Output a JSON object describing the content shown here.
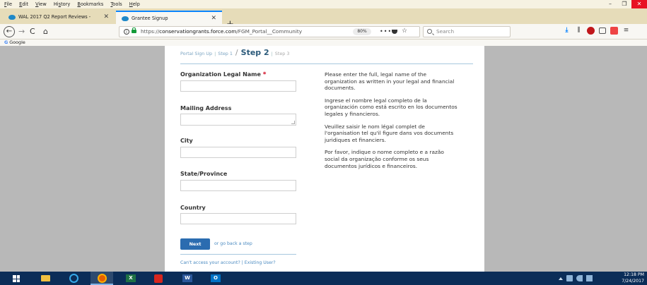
{
  "menubar": {
    "items": [
      {
        "key": "F",
        "rest": "ile"
      },
      {
        "key": "E",
        "rest": "dit"
      },
      {
        "key": "V",
        "rest": "iew"
      },
      {
        "key": "",
        "rest": "Hi",
        "key2": "s",
        "rest2": "tory"
      },
      {
        "key": "B",
        "rest": "ookmarks"
      },
      {
        "key": "T",
        "rest": "ools"
      },
      {
        "key": "H",
        "rest": "elp"
      }
    ],
    "window_controls": {
      "minimize": "–",
      "maximize": "❐",
      "close": "✕"
    }
  },
  "tabs": [
    {
      "title": "WAL 2017 Q2 Report Reviews -",
      "close": "✕",
      "active": false
    },
    {
      "title": "Grantee Signup",
      "close": "✕",
      "active": true
    }
  ],
  "new_tab_label": "+",
  "navbar": {
    "back": "←",
    "forward": "→",
    "reload": "C",
    "home": "⌂",
    "url_scheme": "https://",
    "url_domain": "conservationgrants.force.com",
    "url_path": "/FGM_Portal__Community",
    "zoom": "80%",
    "page_actions": "•••",
    "search_placeholder": "Search"
  },
  "bookmarks": {
    "items": [
      {
        "icon": "G",
        "label": "Google"
      }
    ]
  },
  "page": {
    "steps": {
      "portal_sign_up": "Portal Sign Up",
      "step1": "Step 1",
      "current": "Step 2",
      "step3": "Step 3"
    },
    "fields": [
      {
        "label": "Organization Legal Name",
        "required": true,
        "value": "",
        "type": "input"
      },
      {
        "label": "Mailing Address",
        "required": false,
        "value": "",
        "type": "textarea"
      },
      {
        "label": "City",
        "required": false,
        "value": "",
        "type": "input"
      },
      {
        "label": "State/Province",
        "required": false,
        "value": "",
        "type": "input"
      },
      {
        "label": "Country",
        "required": false,
        "value": "",
        "type": "input"
      }
    ],
    "required_mark": "*",
    "help_text": [
      "Please enter the full, legal name of the organization as written in your legal and financial documents.",
      "Ingrese el nombre legal completo de la organización como está escrito en los documentos legales y financieros.",
      "Veuillez saisir le nom légal complet de l'organisation tel qu'il figure dans vos documents juridiques et financiers.",
      "Por favor, indique o nome completo e a razão social da organização conforme os seus documentos jurídicos e financeiros."
    ],
    "next_button": "Next",
    "go_back_link": "or go back a step",
    "footer_links": {
      "cant_access": "Can't access your account?",
      "separator": "|",
      "existing_user": "Existing User?"
    }
  },
  "taskbar": {
    "apps": [
      {
        "name": "file-explorer"
      },
      {
        "name": "internet-explorer"
      },
      {
        "name": "firefox"
      },
      {
        "name": "excel",
        "glyph": "X"
      },
      {
        "name": "acrobat"
      },
      {
        "name": "word",
        "glyph": "W"
      },
      {
        "name": "outlook",
        "glyph": "O"
      }
    ],
    "clock": {
      "time": "12:18 PM",
      "date": "7/24/2017"
    }
  },
  "colors": {
    "accent": "#0a84ff",
    "next_button": "#2b6cb0",
    "link": "#4a8ac0",
    "step_current": "#2b5a7a",
    "required": "#d0021b",
    "taskbar": "#0b2d58"
  }
}
